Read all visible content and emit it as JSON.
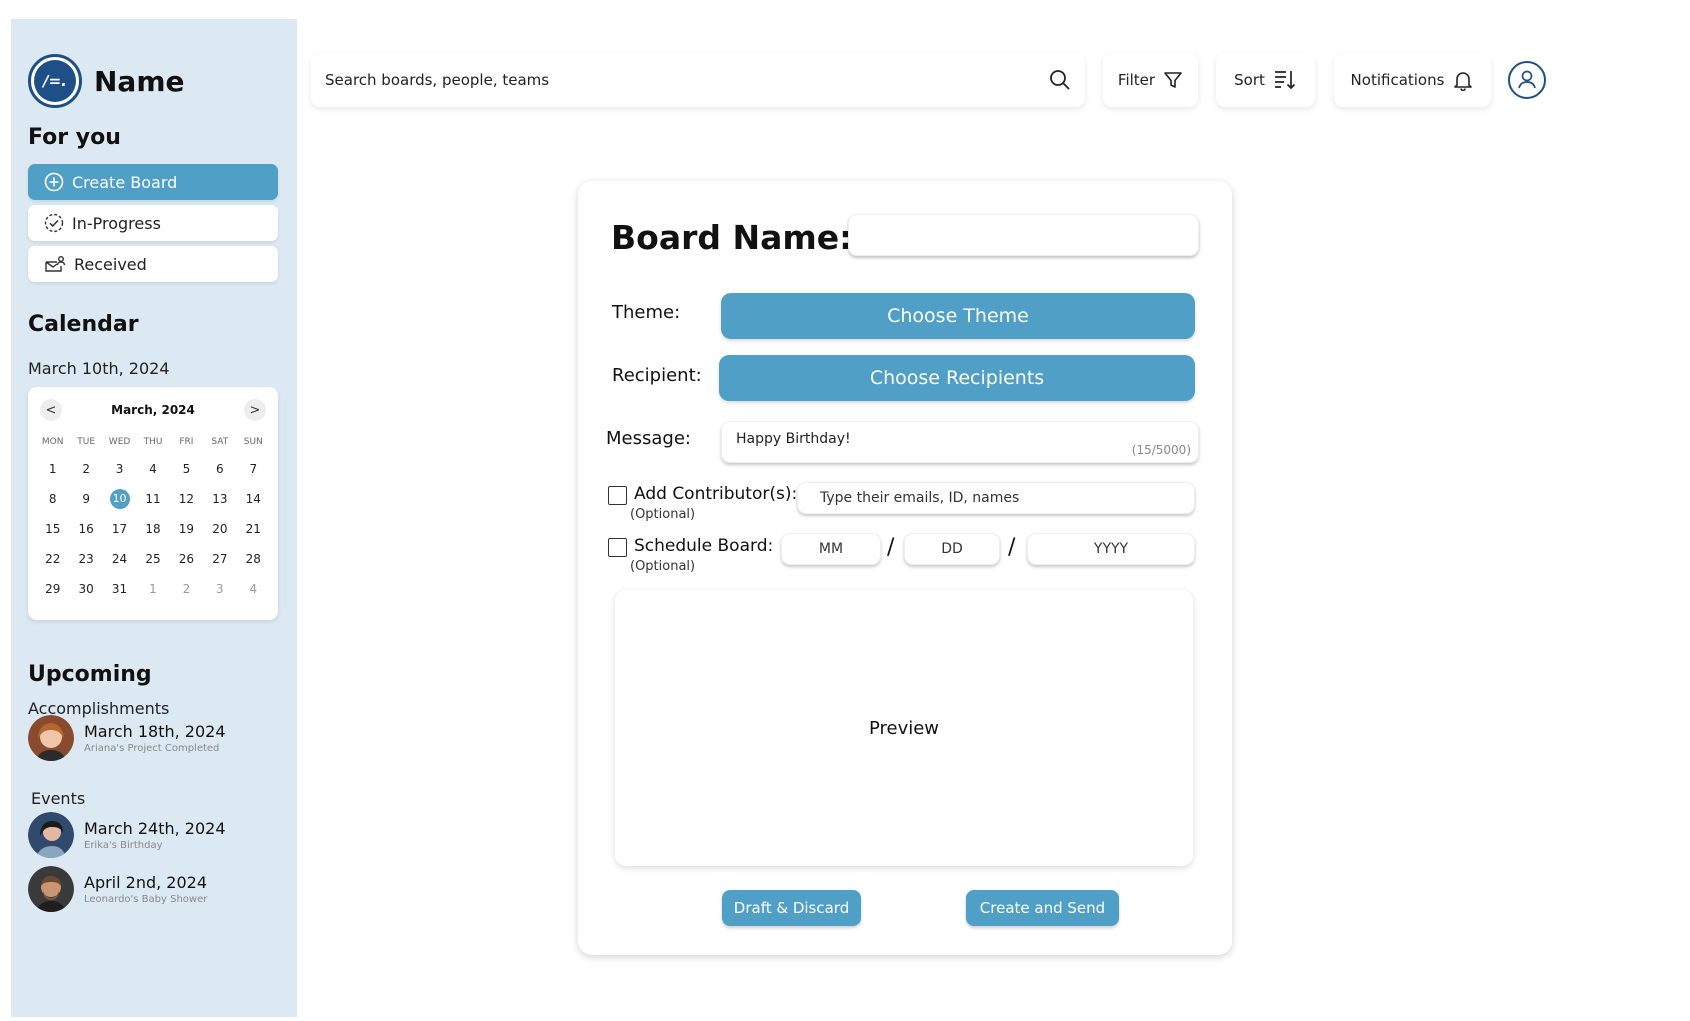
{
  "brand": {
    "name": "Name",
    "logo_text": "/=."
  },
  "sidebar": {
    "for_you_title": "For you",
    "nav": [
      {
        "label": "Create Board",
        "icon": "plus-circle-icon"
      },
      {
        "label": "In-Progress",
        "icon": "progress-check-icon"
      },
      {
        "label": "Received",
        "icon": "envelope-person-icon"
      }
    ],
    "calendar_title": "Calendar",
    "calendar_date": "March 10th, 2024",
    "calendar": {
      "prev": "<",
      "next": ">",
      "month_label": "March, 2024",
      "weekdays": [
        "MON",
        "TUE",
        "WED",
        "THU",
        "FRI",
        "SAT",
        "SUN"
      ],
      "days": [
        "1",
        "2",
        "3",
        "4",
        "5",
        "6",
        "7",
        "8",
        "9",
        "10",
        "11",
        "12",
        "13",
        "14",
        "15",
        "16",
        "17",
        "18",
        "19",
        "20",
        "21",
        "22",
        "23",
        "24",
        "25",
        "26",
        "27",
        "28",
        "29",
        "30",
        "31",
        "1",
        "2",
        "3",
        "4"
      ],
      "selected_day": "10"
    },
    "upcoming_title": "Upcoming",
    "accomplishments_label": "Accomplishments",
    "accomplishments": [
      {
        "date": "March 18th, 2024",
        "note": "Ariana's Project Completed"
      }
    ],
    "events_label": "Events",
    "events": [
      {
        "date": "March 24th, 2024",
        "note": "Erika's Birthday"
      },
      {
        "date": "April 2nd, 2024",
        "note": "Leonardo's Baby Shower"
      }
    ]
  },
  "topbar": {
    "search_placeholder": "Search boards, people, teams",
    "filter_label": "Filter",
    "sort_label": "Sort",
    "notifications_label": "Notifications"
  },
  "form": {
    "board_name_label": "Board Name:",
    "board_name_value": "",
    "theme_label": "Theme:",
    "theme_button": "Choose Theme",
    "recipient_label": "Recipient:",
    "recipient_button": "Choose Recipients",
    "message_label": "Message:",
    "message_value": "Happy Birthday!",
    "message_count": "(15/5000)",
    "contributor_label": "Add Contributor(s):",
    "contributor_optional": "(Optional)",
    "contributor_placeholder": "Type their emails, ID, names",
    "schedule_label": "Schedule Board:",
    "schedule_optional": "(Optional)",
    "schedule_mm": "MM",
    "schedule_dd": "DD",
    "schedule_yyyy": "YYYY",
    "date_separator": "/",
    "preview_label": "Preview",
    "draft_button": "Draft & Discard",
    "create_button": "Create and Send"
  },
  "colors": {
    "accent": "#4f9fc6",
    "sidebar_bg": "#dce9f2",
    "brand_dark": "#1e4f86"
  }
}
